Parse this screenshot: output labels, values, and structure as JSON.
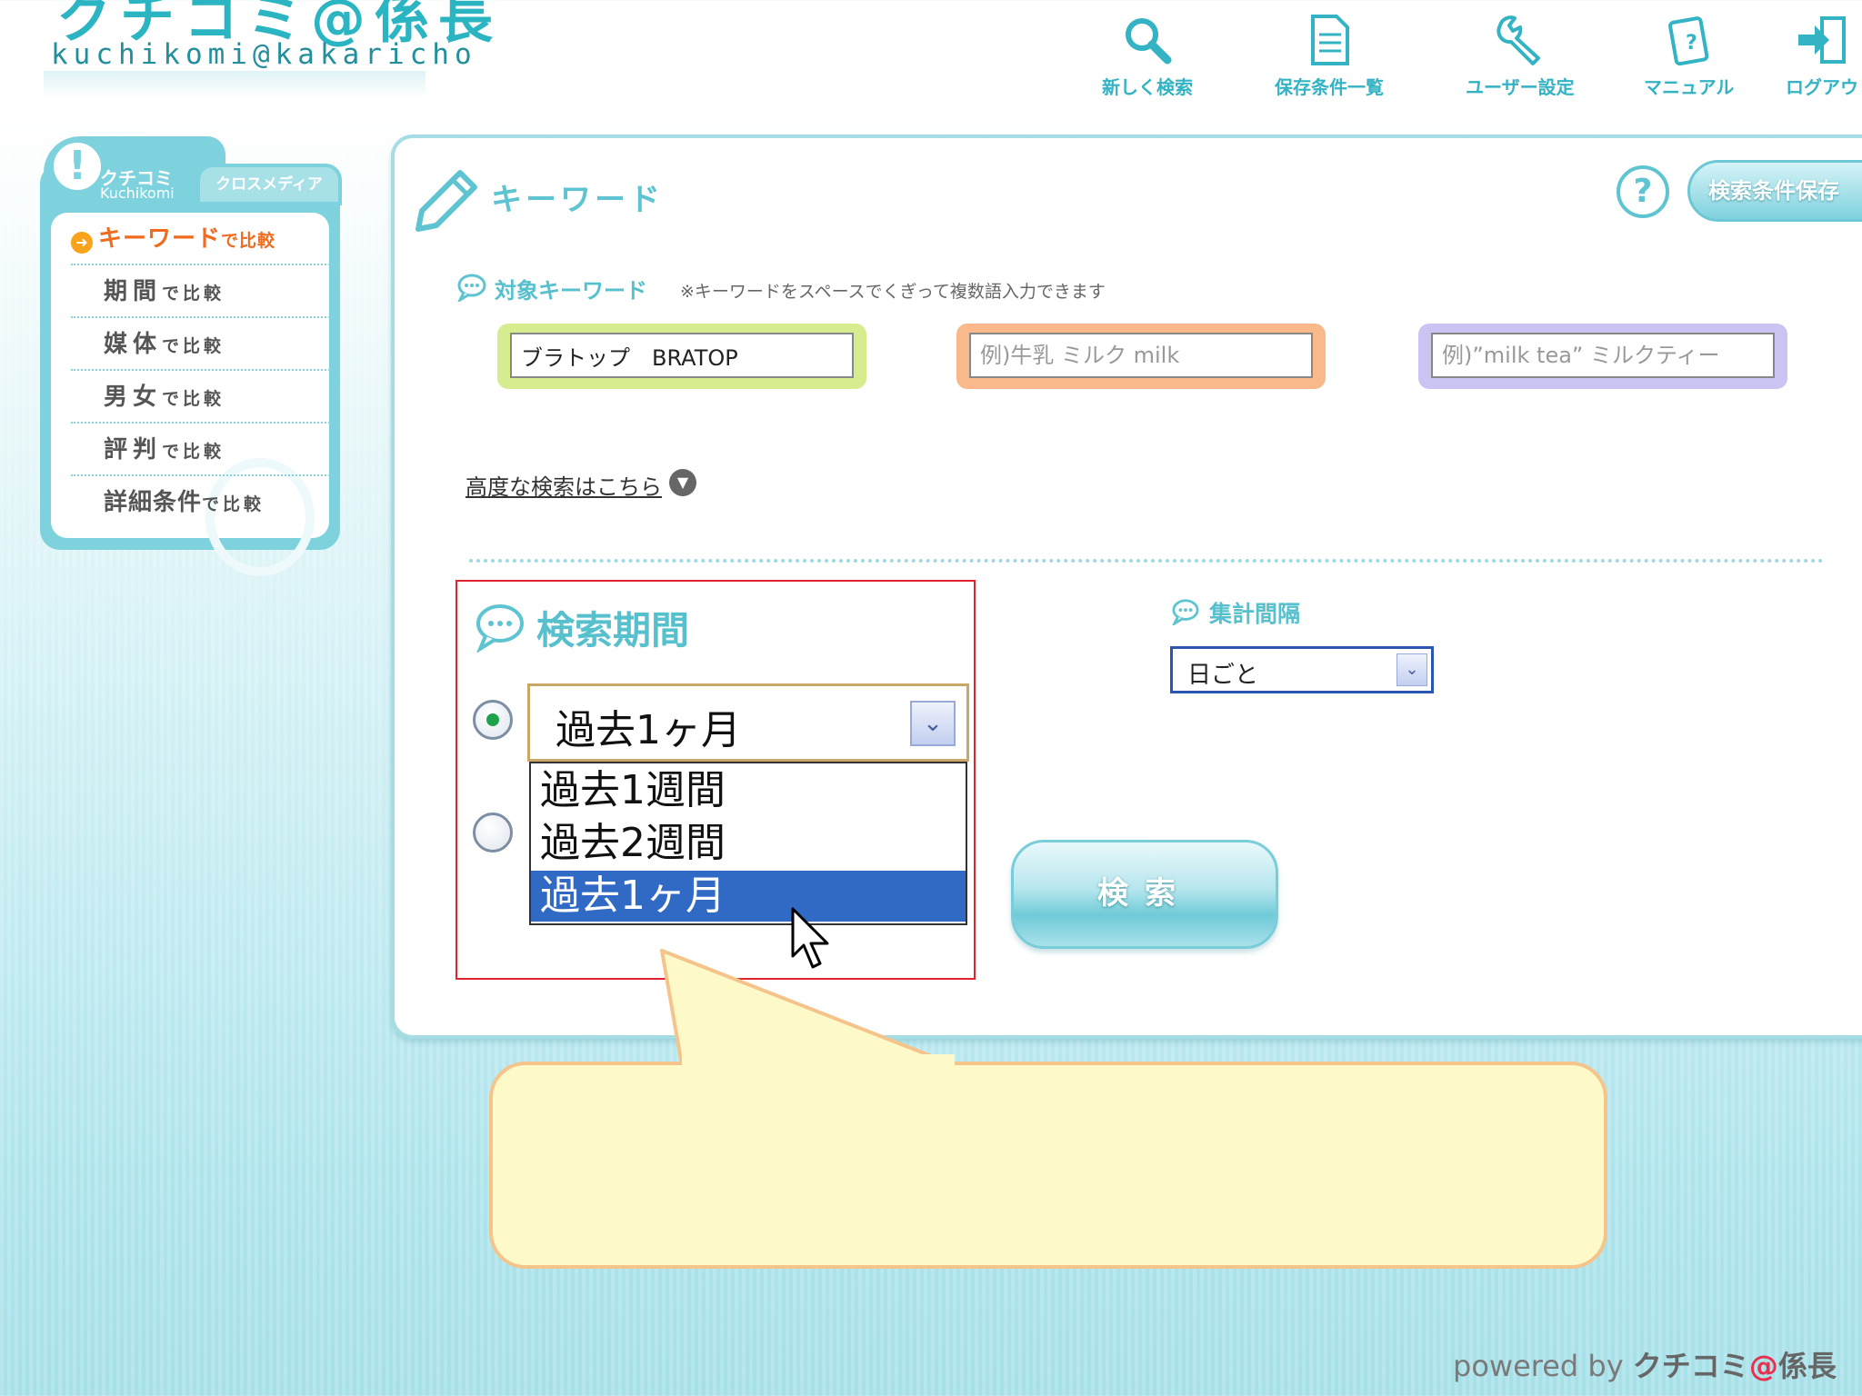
{
  "logo": {
    "title": "クチコミ@係長",
    "subtitle": "kuchikomi@kakaricho"
  },
  "nav": [
    {
      "label": "新しく検索",
      "icon": "search-icon"
    },
    {
      "label": "保存条件一覧",
      "icon": "document-icon"
    },
    {
      "label": "ユーザー設定",
      "icon": "wrench-icon"
    },
    {
      "label": "マニュアル",
      "icon": "manual-icon"
    },
    {
      "label": "ログアウ",
      "icon": "logout-icon"
    }
  ],
  "sidebar": {
    "tab_title": "クチコミ",
    "tab_subtitle": "Kuchikomi",
    "tab_secondary": "クロスメディア",
    "items": [
      {
        "big": "キーワード",
        "small": "で比較",
        "active": true
      },
      {
        "big": "期間",
        "small": "で比較"
      },
      {
        "big": "媒体",
        "small": "で比較"
      },
      {
        "big": "男女",
        "small": "で比較"
      },
      {
        "big": "評判",
        "small": "で比較"
      },
      {
        "big": "詳細条件",
        "small": "で比較"
      }
    ]
  },
  "panel": {
    "title": "キーワード",
    "help": "?",
    "save_label": "検索条件保存"
  },
  "keywords": {
    "label": "対象キーワード",
    "note": "※キーワードをスペースでくぎって複数語入力できます",
    "fields": [
      {
        "value": "ブラトップ　BRATOP",
        "placeholder": "",
        "color": "#d6ec8f"
      },
      {
        "value": "",
        "placeholder": "例)牛乳 ミルク milk",
        "color": "#f9b98a"
      },
      {
        "value": "",
        "placeholder": "例)”milk tea” ミルクティー",
        "color": "#c9c4f2"
      }
    ]
  },
  "advanced_link": "高度な検索はこちら",
  "period": {
    "label": "検索期間",
    "selected": "過去1ヶ月",
    "options": [
      "過去1週間",
      "過去2週間",
      "過去1ヶ月"
    ],
    "highlighted_index": 2
  },
  "aggregation": {
    "label": "集計間隔",
    "selected": "日ごと"
  },
  "search_button": "検索",
  "footer": {
    "powered": "powered by",
    "brand_a": "クチコミ",
    "brand_at": "@",
    "brand_b": "係長"
  },
  "colors": {
    "accent": "#5ec4d1",
    "active": "#f06b1d",
    "highlight": "#316ac5",
    "frame": "#e0242f"
  }
}
